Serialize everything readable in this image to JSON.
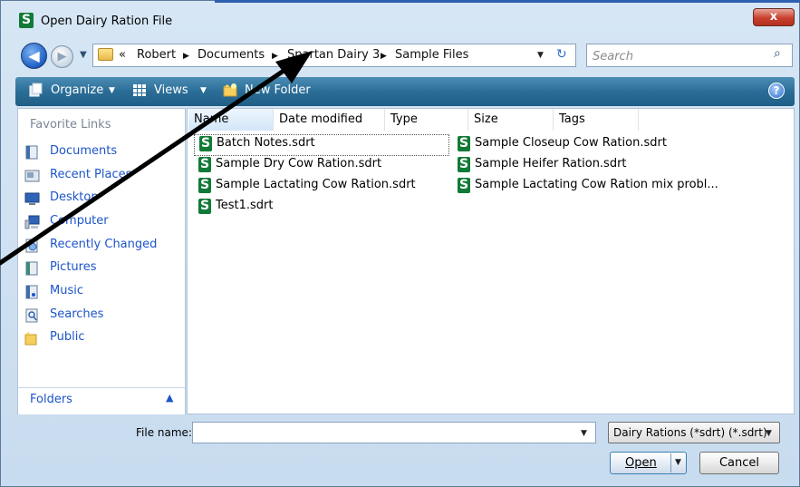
{
  "window": {
    "title": "Open Dairy Ration File",
    "close_label": "x"
  },
  "navigation": {
    "breadcrumb_prefix": "«",
    "breadcrumb": [
      "Robert",
      "Documents",
      "Spartan Dairy 3",
      "Sample Files"
    ],
    "search_placeholder": "Search"
  },
  "toolbar": {
    "organize": "Organize",
    "views": "Views",
    "new_folder": "New Folder",
    "help": "?"
  },
  "favorites": {
    "title": "Favorite Links",
    "items": [
      "Documents",
      "Recent Places",
      "Desktop",
      "Computer",
      "Recently Changed",
      "Pictures",
      "Music",
      "Searches",
      "Public"
    ],
    "folders_label": "Folders"
  },
  "columns": [
    "Name",
    "Date modified",
    "Type",
    "Size",
    "Tags"
  ],
  "files": [
    "Batch Notes.sdrt",
    "Sample Dry Cow Ration.sdrt",
    "Sample Lactating Cow Ration.sdrt",
    "Test1.sdrt",
    "Sample Closeup Cow Ration.sdrt",
    "Sample Heifer Ration.sdrt",
    "Sample Lactating Cow Ration mix probl..."
  ],
  "footer": {
    "file_name_label": "File name:",
    "file_name_value": "",
    "file_type": "Dairy Rations (*sdrt) (*.sdrt)",
    "open_label": "Open",
    "cancel_label": "Cancel"
  },
  "colors": {
    "toolbar": "#2a6d97",
    "link": "#1d55c9",
    "sdrt_icon": "#127a37",
    "annotation_arrow": "#000000"
  }
}
